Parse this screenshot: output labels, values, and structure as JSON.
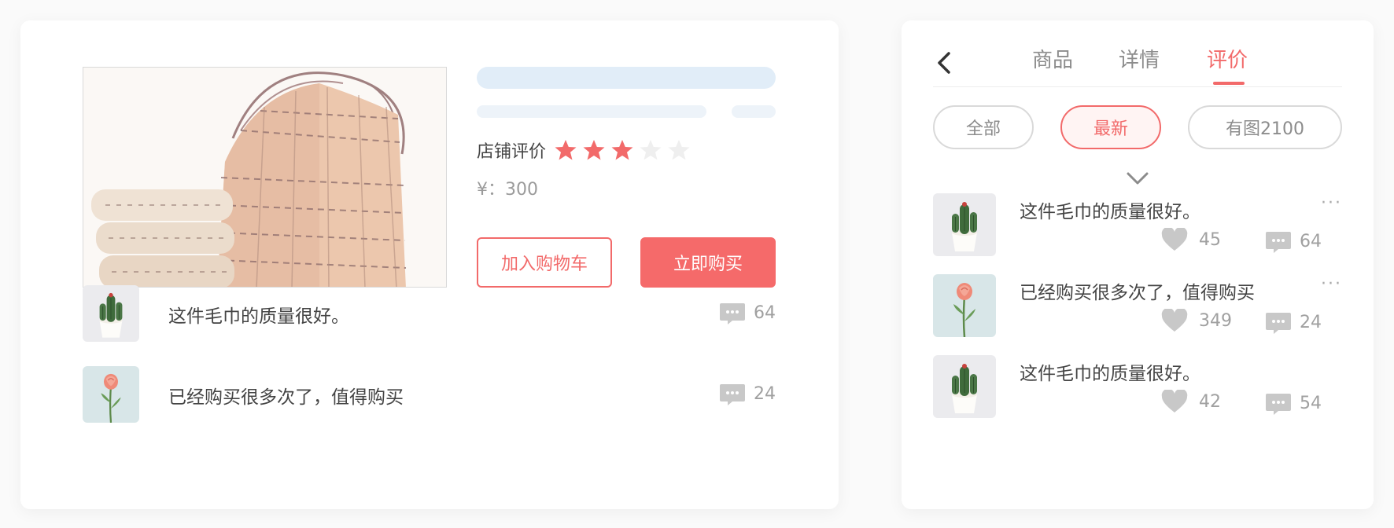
{
  "product": {
    "rating_label": "店铺评价",
    "rating": 3,
    "rating_max": 5,
    "price": "¥：300",
    "add_to_cart": "加入购物车",
    "buy_now": "立即购买"
  },
  "left_reviews": [
    {
      "text": "这件毛巾的质量很好。",
      "comments": "64",
      "thumb": "cactus"
    },
    {
      "text": "已经购买很多次了，值得购买",
      "comments": "24",
      "thumb": "rose"
    }
  ],
  "tabs": [
    {
      "label": "商品"
    },
    {
      "label": "详情"
    },
    {
      "label": "评价",
      "active": true
    }
  ],
  "filters": [
    {
      "label": "全部"
    },
    {
      "label": "最新",
      "active": true
    },
    {
      "label": "有图2100"
    }
  ],
  "right_reviews": [
    {
      "text": "这件毛巾的质量很好。",
      "likes": "45",
      "comments": "64",
      "more": "···",
      "thumb": "cactus"
    },
    {
      "text": "已经购买很多次了，值得购买",
      "likes": "349",
      "comments": "24",
      "more": "···",
      "thumb": "rose"
    },
    {
      "text": "这件毛巾的质量很好。",
      "likes": "42",
      "comments": "54",
      "more": "",
      "thumb": "cactus"
    }
  ],
  "colors": {
    "accent": "#f26a6a",
    "star_active": "#f26a6a",
    "star_inactive": "#efefef",
    "icon_gray": "#c8c8c8"
  }
}
